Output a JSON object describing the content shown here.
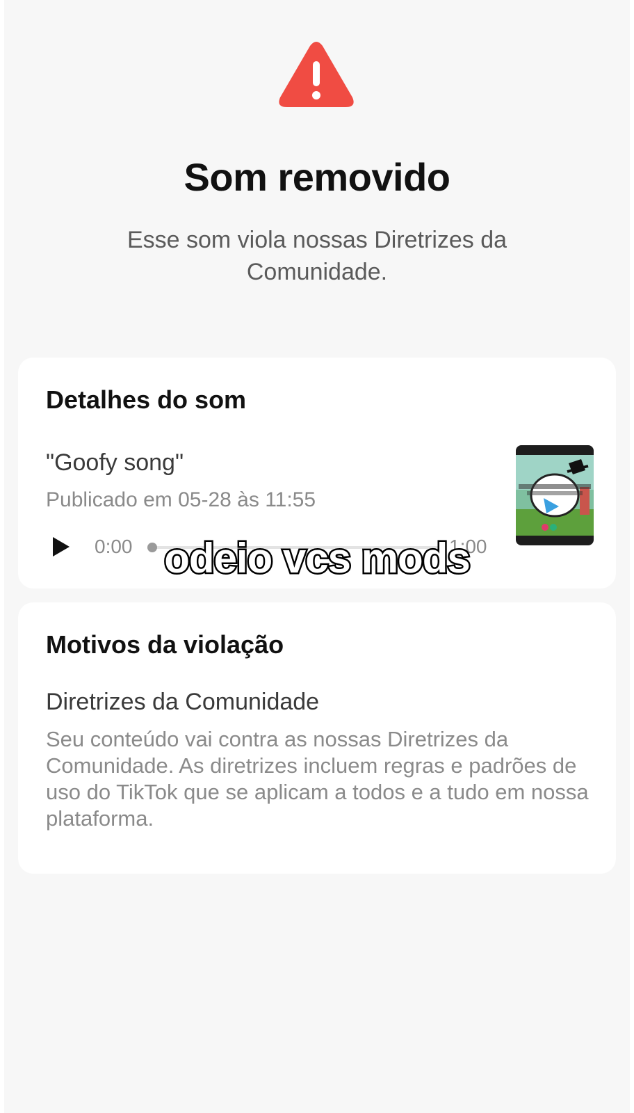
{
  "header": {
    "icon": "warning-triangle-icon",
    "icon_color": "#f04c43",
    "title": "Som removido",
    "subtitle": "Esse som viola nossas Diretrizes da Comunidade."
  },
  "sound_details": {
    "heading": "Detalhes do som",
    "name": "\"Goofy song\"",
    "published": "Publicado em 05-28 às 11:55",
    "player": {
      "play_icon": "play-icon",
      "current_time": "0:00",
      "duration": "1:00",
      "progress": 0
    },
    "thumbnail_icon": "sound-cover-thumbnail"
  },
  "violation": {
    "heading": "Motivos da violação",
    "reason_title": "Diretrizes da Comunidade",
    "reason_description": "Seu conteúdo vai contra as nossas Diretrizes da Comunidade. As diretrizes incluem regras e padrões de uso do TikTok que se aplicam a todos e a tudo em nossa plataforma."
  },
  "overlay": {
    "caption": "odeio vcs mods"
  }
}
